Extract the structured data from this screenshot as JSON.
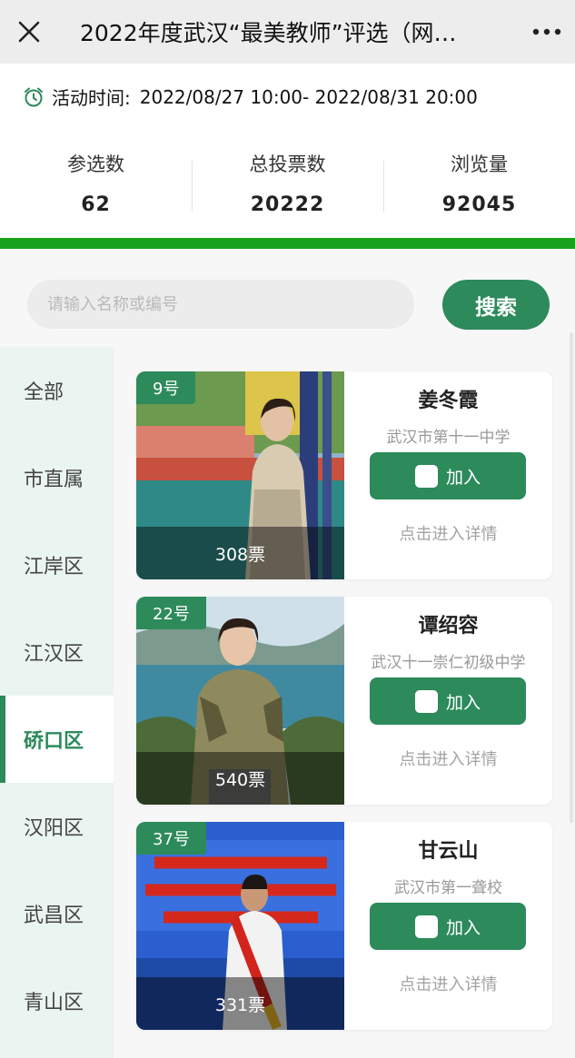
{
  "window": {
    "title": "2022年度武汉“最美教师”评选（网…"
  },
  "activity": {
    "time_label": "活动时间:",
    "time_value": "2022/08/27 10:00- 2022/08/31 20:00"
  },
  "stats": [
    {
      "label": "参选数",
      "value": "62"
    },
    {
      "label": "总投票数",
      "value": "20222"
    },
    {
      "label": "浏览量",
      "value": "92045"
    }
  ],
  "search": {
    "placeholder": "请输入名称或编号",
    "button": "搜索"
  },
  "sidebar": {
    "items": [
      {
        "label": "全部"
      },
      {
        "label": "市直属"
      },
      {
        "label": "江岸区"
      },
      {
        "label": "江汉区"
      },
      {
        "label": "硚口区"
      },
      {
        "label": "汉阳区"
      },
      {
        "label": "武昌区"
      },
      {
        "label": "青山区"
      }
    ],
    "active_index": 4
  },
  "candidates": [
    {
      "number": "9号",
      "name": "姜冬霞",
      "school": "武汉市第十一中学",
      "votes": "308票",
      "join_label": "加入",
      "detail_label": "点击进入详情"
    },
    {
      "number": "22号",
      "name": "谭绍容",
      "school": "武汉十一崇仁初级中学",
      "votes": "540票",
      "join_label": "加入",
      "detail_label": "点击进入详情"
    },
    {
      "number": "37号",
      "name": "甘云山",
      "school": "武汉市第一聋校",
      "votes": "331票",
      "join_label": "加入",
      "detail_label": "点击进入详情"
    }
  ],
  "colors": {
    "accent": "#2c8a5b",
    "progress_bar": "#17a21b",
    "sidebar_bg": "#eaf4f0"
  }
}
